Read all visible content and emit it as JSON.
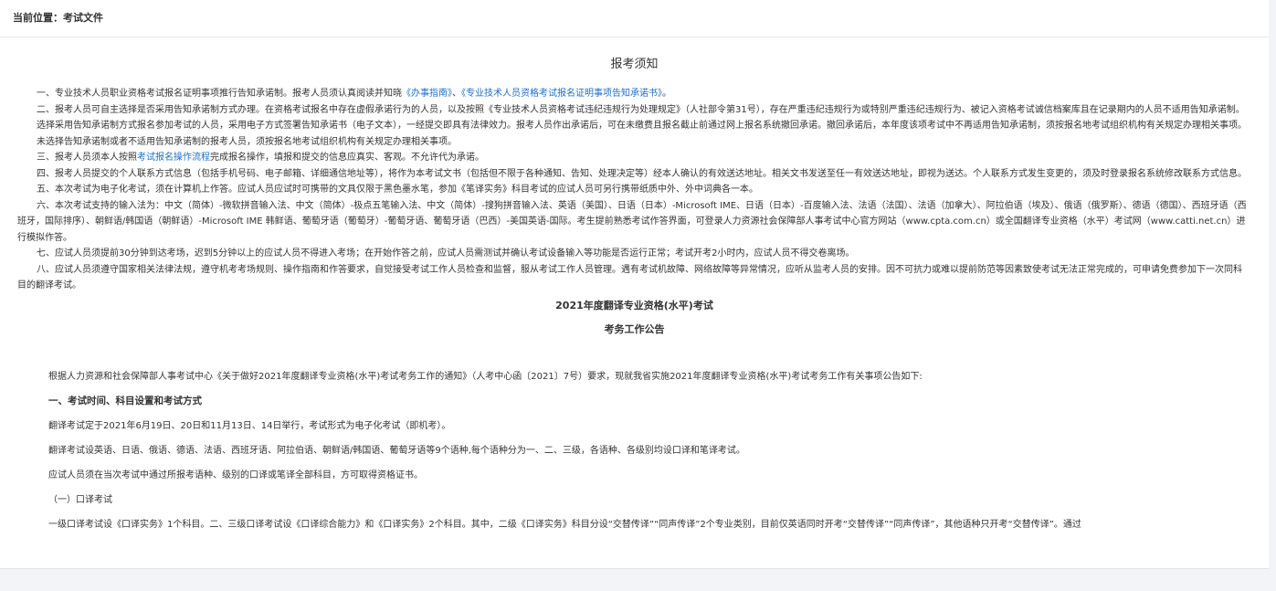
{
  "breadcrumb": "当前位置：考试文件",
  "page_title": "报考须知",
  "notice": {
    "p1_pre": "一、专业技术人员职业资格考试报名证明事项推行告知承诺制。报考人员须认真阅读并知晓",
    "p1_link1": "《办事指南》",
    "p1_mid": "、",
    "p1_link2": "《专业技术人员资格考试报名证明事项告知承诺书》",
    "p1_post": "。",
    "p2": "二、报考人员可自主选择是否采用告知承诺制方式办理。在资格考试报名中存在虚假承诺行为的人员，以及按照《专业技术人员资格考试违纪违规行为处理规定》（人社部令第31号），存在严重违纪违规行为或特别严重违纪违规行为、被记入资格考试诚信档案库且在记录期内的人员不适用告知承诺制。",
    "p3": "选择采用告知承诺制方式报名参加考试的人员，采用电子方式签署告知承诺书（电子文本），一经提交即具有法律效力。报考人员作出承诺后，可在未缴费且报名截止前通过网上报名系统撤回承诺。撤回承诺后，本年度该项考试中不再适用告知承诺制，须按报名地考试组织机构有关规定办理相关事项。",
    "p4": "未选择告知承诺制或者不适用告知承诺制的报考人员，须按报名地考试组织机构有关规定办理相关事项。",
    "p5_pre": "三、报考人员须本人按照",
    "p5_link": "考试报名操作流程",
    "p5_post": "完成报名操作，填报和提交的信息应真实、客观。不允许代为承诺。",
    "p6": "四、报考人员提交的个人联系方式信息（包括手机号码、电子邮箱、详细通信地址等），将作为本考试文书（包括但不限于各种通知、告知、处理决定等）经本人确认的有效送达地址。相关文书发送至任一有效送达地址，即视为送达。个人联系方式发生变更的，须及时登录报名系统修改联系方式信息。",
    "p7": "五、本次考试为电子化考试，须在计算机上作答。应试人员应试时可携带的文具仅限于黑色墨水笔，参加《笔译实务》科目考试的应试人员可另行携带纸质中外、外中词典各一本。",
    "p8": "六、本次考试支持的输入法为：中文（简体）-微软拼音输入法、中文（简体）-极点五笔输入法、中文（简体）-搜狗拼音输入法、英语（美国）、日语（日本）-Microsoft IME、日语（日本）-百度输入法、法语（法国）、法语（加拿大）、阿拉伯语（埃及）、俄语（俄罗斯）、德语（德国）、西班牙语（西班牙，国际排序）、朝鲜语/韩国语（朝鲜语）-Microsoft IME 韩鲜语、葡萄牙语（葡萄牙）-葡萄牙语、葡萄牙语（巴西）-美国英语-国际。考生提前熟悉考试作答界面，可登录人力资源社会保障部人事考试中心官方网站（www.cpta.com.cn）或全国翻译专业资格（水平）考试网（www.catti.net.cn）进行模拟作答。",
    "p9": "七、应试人员须提前30分钟到达考场，迟到5分钟以上的应试人员不得进入考场；在开始作答之前，应试人员需测试并确认考试设备输入等功能是否运行正常；考试开考2小时内，应试人员不得交卷离场。",
    "p10": "八、应试人员须遵守国家相关法律法规，遵守机考考场规则、操作指南和作答要求，自觉接受考试工作人员检查和监督，服从考试工作人员管理。遇有考试机故障、网络故障等异常情况，应听从监考人员的安排。因不可抗力或难以提前防范等因素致使考试无法正常完成的，可申请免费参加下一次同科目的翻译考试。"
  },
  "announcement": {
    "title": "2021年度翻译专业资格(水平)考试",
    "subtitle": "考务工作公告",
    "intro": "根据人力资源和社会保障部人事考试中心《关于做好2021年度翻译专业资格(水平)考试考务工作的通知》（人考中心函〔2021〕7号）要求，现就我省实施2021年度翻译专业资格(水平)考试考务工作有关事项公告如下:",
    "section1": "一、考试时间、科目设置和考试方式",
    "s1_p1": "翻译考试定于2021年6月19日、20日和11月13日、14日举行，考试形式为电子化考试（即机考）。",
    "s1_p2": "翻译考试设英语、日语、俄语、德语、法语、西班牙语、阿拉伯语、朝鲜语/韩国语、葡萄牙语等9个语种,每个语种分为一、二、三级，各语种、各级别均设口译和笔译考试。",
    "s1_p3": "应试人员须在当次考试中通过所报考语种、级别的口译或笔译全部科目，方可取得资格证书。",
    "sub1": "（一）口译考试",
    "s1_p4": "一级口译考试设《口译实务》1个科目。二、三级口译考试设《口译综合能力》和《口译实务》2个科目。其中，二级《口译实务》科目分设“交替传译”“同声传译”2个专业类别，目前仅英语同时开考“交替传译”“同声传译”，其他语种只开考“交替传译”。通过"
  }
}
